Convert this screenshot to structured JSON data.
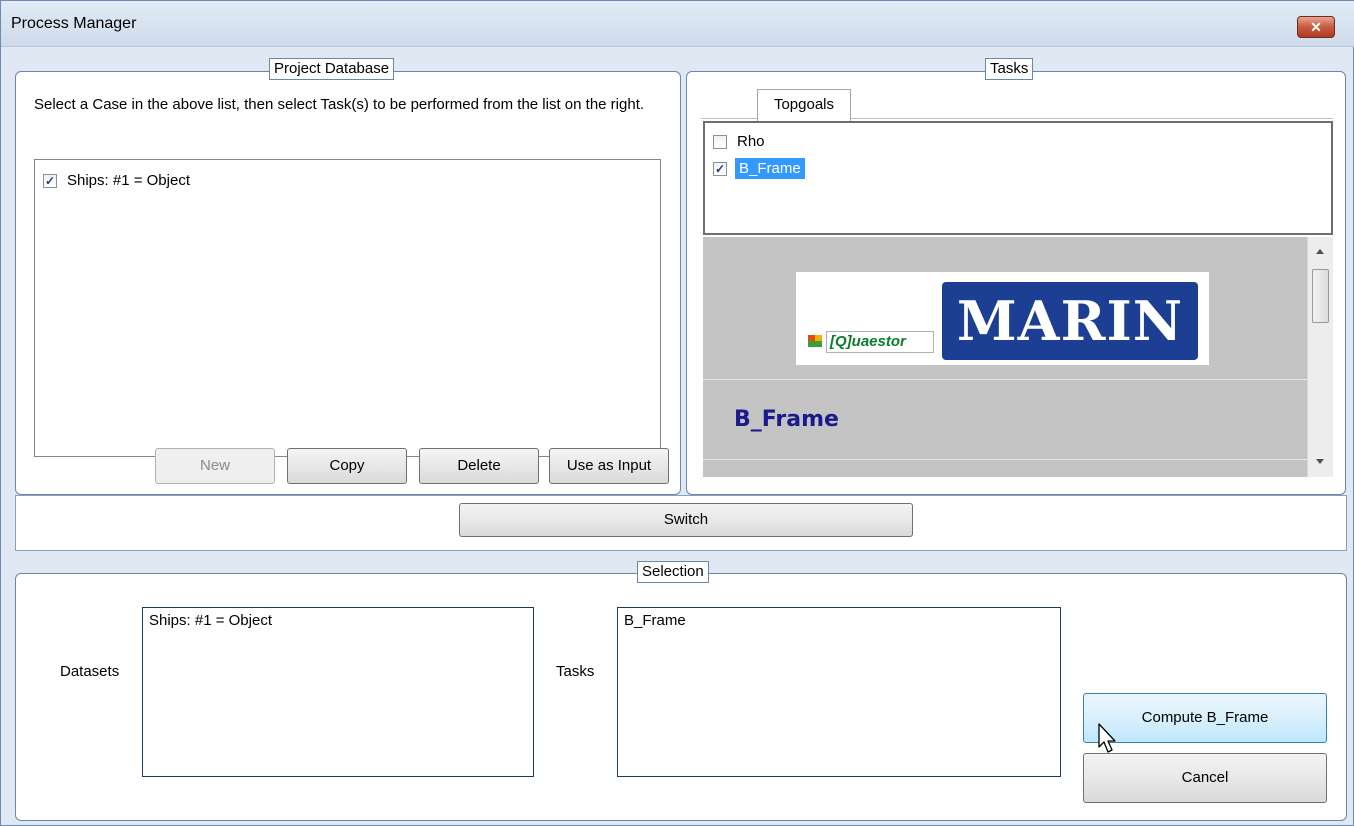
{
  "window": {
    "title": "Process Manager",
    "close_glyph": "✕"
  },
  "project_database": {
    "legend": "Project Database",
    "instruction": "Select a Case in the above list, then select Task(s) to be performed from the list on the right.",
    "cases": [
      {
        "label": "Ships: #1 = Object",
        "checked": true
      }
    ],
    "buttons": {
      "new": "New",
      "copy": "Copy",
      "delete": "Delete",
      "use_as_input": "Use as Input"
    }
  },
  "tasks": {
    "legend": "Tasks",
    "tab": "Topgoals",
    "items": [
      {
        "label": "Rho",
        "checked": false,
        "selected": false
      },
      {
        "label": "B_Frame",
        "checked": true,
        "selected": true
      }
    ],
    "preview": {
      "logo_marin": "MARIN",
      "logo_quaestor": "[Q]uaestor",
      "heading": "B_Frame"
    }
  },
  "switch_button": "Switch",
  "selection": {
    "legend": "Selection",
    "datasets_label": "Datasets",
    "datasets_value": "Ships: #1 = Object",
    "tasks_label": "Tasks",
    "tasks_value": "B_Frame",
    "compute_button": "Compute B_Frame",
    "cancel_button": "Cancel"
  },
  "colors": {
    "accent": "#1e5fb0",
    "highlight": "#3399ff",
    "marin_blue": "#1c3f94",
    "heading_navy": "#1a1a8c"
  }
}
